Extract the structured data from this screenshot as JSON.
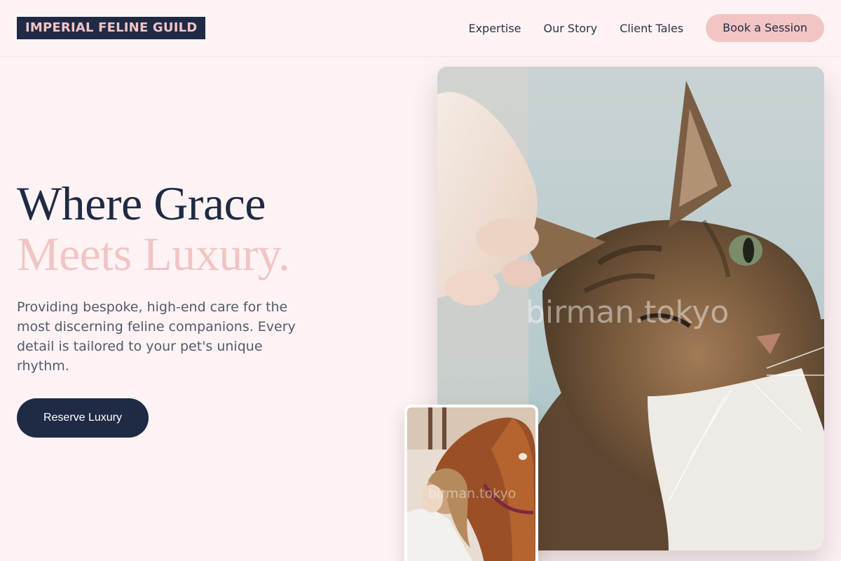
{
  "brand": {
    "logo_text": "IMPERIAL FELINE GUILD"
  },
  "nav": {
    "items": [
      {
        "label": "Expertise"
      },
      {
        "label": "Our Story"
      },
      {
        "label": "Client Tales"
      }
    ],
    "cta_label": "Book a Session"
  },
  "hero": {
    "title_line1": "Where Grace",
    "title_line2": "Meets Luxury.",
    "subtitle": "Providing bespoke, high-end care for the most discerning feline companions. Every detail is tailored to your pet's unique rhythm.",
    "button_label": "Reserve Luxury"
  },
  "images": {
    "main_watermark": "birman.tokyo",
    "small_watermark": "birman.tokyo"
  },
  "colors": {
    "background": "#fdf3f4",
    "navy": "#1f2a44",
    "pink": "#f2c4c4",
    "body_text": "#525a6b"
  }
}
